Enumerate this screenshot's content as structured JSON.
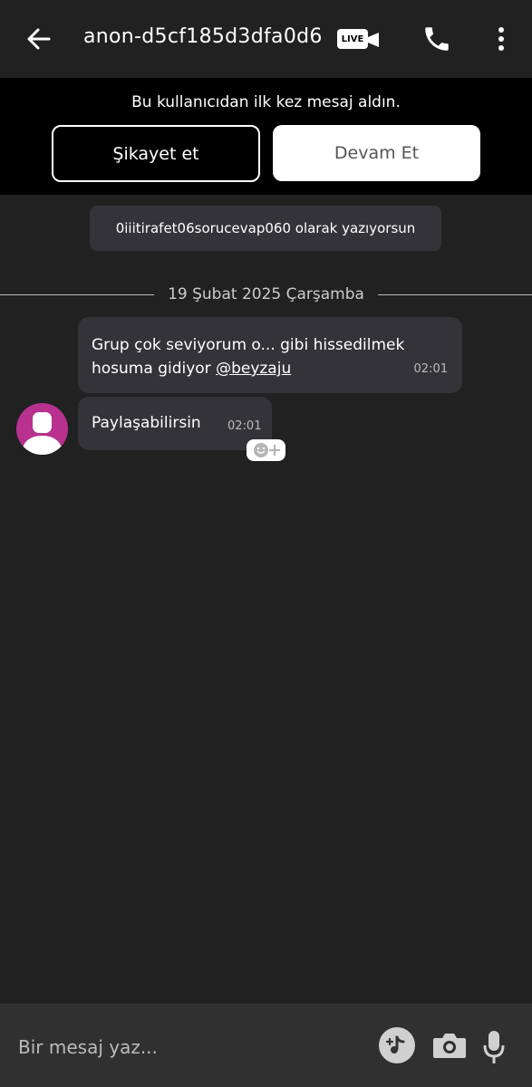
{
  "header": {
    "title": "anon-d5cf185d3dfa0d6",
    "live_label": "LIVE",
    "icons": [
      "arrow-left-icon",
      "live-video-icon",
      "phone-icon",
      "more-vertical-icon"
    ]
  },
  "notice": {
    "text": "Bu kullanıcıdan ilk kez mesaj aldın.",
    "report_label": "Şikayet et",
    "continue_label": "Devam Et"
  },
  "writing_as": "0iiitirafet06sorucevap060 olarak yazıyorsun",
  "date_divider": "19 Şubat 2025 Çarşamba",
  "messages": [
    {
      "line1": "Grup çok seviyorum o... gibi hissedilmek",
      "line2": "hosuma gidiyor ",
      "mention": "@beyzaju",
      "time": "02:01"
    },
    {
      "text": "Paylaşabilirsin",
      "time": "02:01"
    }
  ],
  "composer": {
    "placeholder": "Bir mesaj yaz...",
    "icons": [
      "music-note-icon",
      "camera-icon",
      "microphone-icon"
    ]
  },
  "colors": {
    "background": "#212121",
    "bubble": "#343438",
    "avatar": "#b8318f"
  }
}
